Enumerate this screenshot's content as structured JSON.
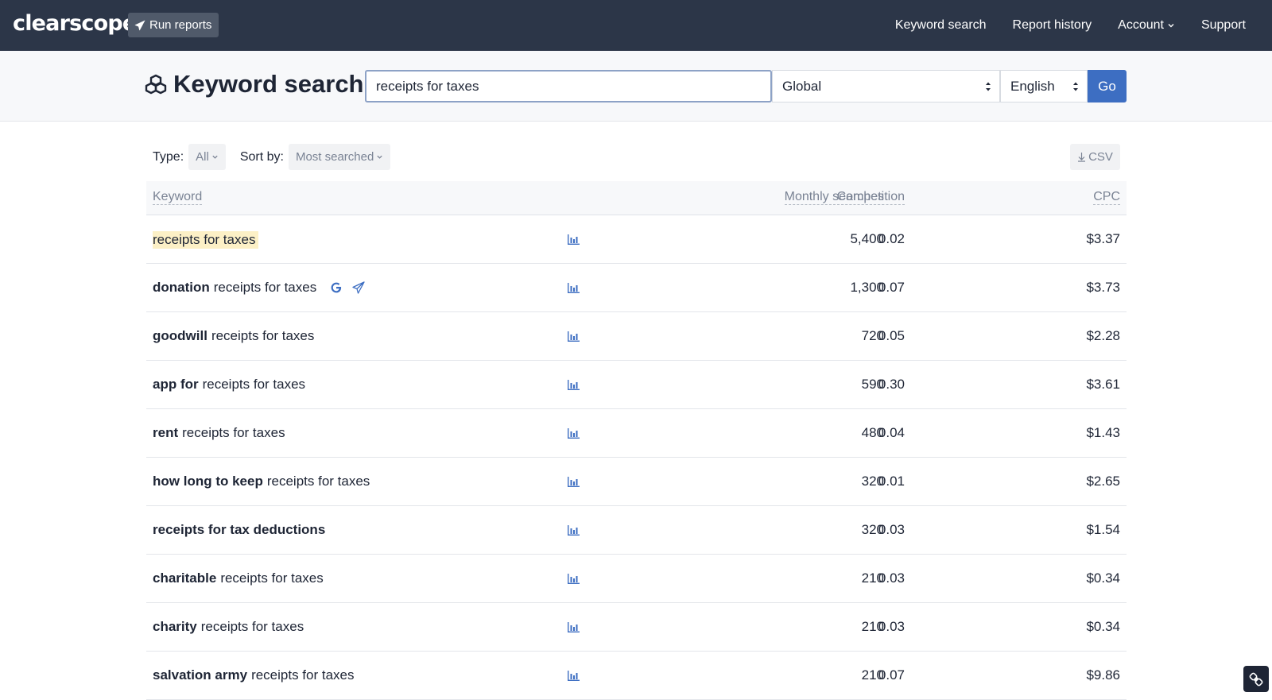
{
  "nav": {
    "logo": "clearscope",
    "run_reports": "Run reports",
    "items": [
      {
        "label": "Keyword search"
      },
      {
        "label": "Report history"
      },
      {
        "label": "Account"
      },
      {
        "label": "Support"
      }
    ]
  },
  "search": {
    "title": "Keyword search",
    "query": "receipts for taxes",
    "region": "Global",
    "language": "English",
    "go_label": "Go"
  },
  "filters": {
    "type_label": "Type:",
    "type_value": "All",
    "sort_label": "Sort by:",
    "sort_value": "Most searched",
    "csv_label": "CSV"
  },
  "table": {
    "headers": {
      "keyword": "Keyword",
      "searches": "Monthly searches",
      "competition": "Competition",
      "cpc": "CPC"
    },
    "rows": [
      {
        "prefix": "",
        "base": "receipts for taxes",
        "highlighted": true,
        "searches": "5,400",
        "competition": "0.02",
        "cpc": "$3.37"
      },
      {
        "prefix": "donation",
        "base": "receipts for taxes",
        "searches": "1,300",
        "competition": "0.07",
        "cpc": "$3.73",
        "show_actions": true
      },
      {
        "prefix": "goodwill",
        "base": "receipts for taxes",
        "searches": "720",
        "competition": "0.05",
        "cpc": "$2.28"
      },
      {
        "prefix": "app for",
        "base": "receipts for taxes",
        "searches": "590",
        "competition": "0.30",
        "cpc": "$3.61"
      },
      {
        "prefix": "rent",
        "base": "receipts for taxes",
        "searches": "480",
        "competition": "0.04",
        "cpc": "$1.43"
      },
      {
        "prefix": "how long to keep",
        "base": "receipts for taxes",
        "searches": "320",
        "competition": "0.01",
        "cpc": "$2.65"
      },
      {
        "prefix": "receipts for tax deductions",
        "base": "",
        "searches": "320",
        "competition": "0.03",
        "cpc": "$1.54"
      },
      {
        "prefix": "charitable",
        "base": "receipts for taxes",
        "searches": "210",
        "competition": "0.03",
        "cpc": "$0.34"
      },
      {
        "prefix": "charity",
        "base": "receipts for taxes",
        "searches": "210",
        "competition": "0.03",
        "cpc": "$0.34"
      },
      {
        "prefix": "salvation army",
        "base": "receipts for taxes",
        "searches": "210",
        "competition": "0.07",
        "cpc": "$9.86"
      }
    ]
  },
  "icons": {
    "run": "paper-plane-icon",
    "title": "cubes-icon",
    "trend": "bar-chart-icon",
    "google": "google-icon",
    "send": "paper-plane-icon",
    "download": "download-arrow-icon",
    "dropdown": "chevron-down-icon",
    "widget": "link-icon"
  },
  "colors": {
    "nav_bg": "#2c3648",
    "accent": "#3d6ec2",
    "highlight": "#fcf0c6"
  }
}
